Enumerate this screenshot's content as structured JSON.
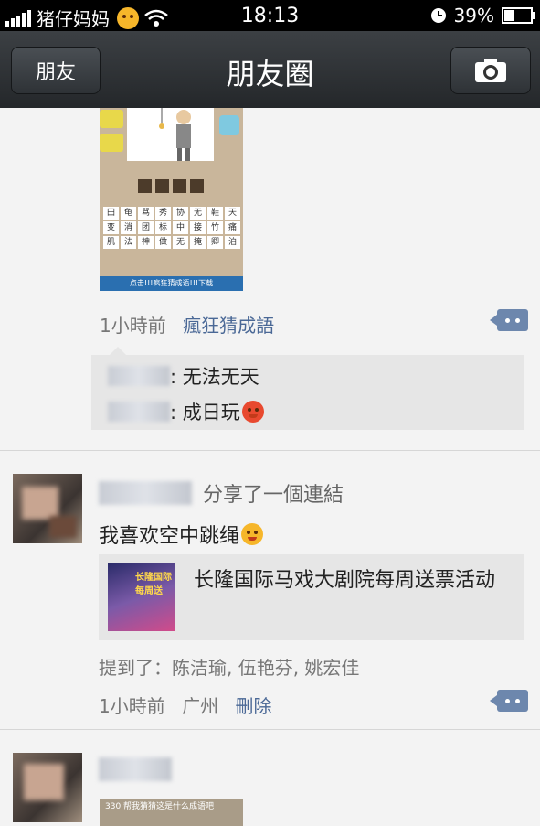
{
  "status_bar": {
    "carrier": "猪仔妈妈",
    "time": "18:13",
    "battery": "39%",
    "battery_level": 0.39
  },
  "nav": {
    "back_label": "朋友",
    "title": "朋友圈",
    "camera_icon": "camera-icon"
  },
  "post1": {
    "image": {
      "chars_row1": [
        "田",
        "龟",
        "骂",
        "秀",
        "协",
        "无",
        "鞋",
        "天"
      ],
      "chars_row2": [
        "变",
        "消",
        "团",
        "标",
        "中",
        "接",
        "竹",
        "痛"
      ],
      "chars_row3": [
        "肌",
        "法",
        "神",
        "做",
        "无",
        "掩",
        "卿",
        "泊"
      ],
      "footer": "点击!!!疯狂猜成语!!!下载"
    },
    "time": "1小時前",
    "app_link": "瘋狂猜成語",
    "comments": [
      {
        "text": ": 无法无天"
      },
      {
        "text": ": 成日玩"
      }
    ]
  },
  "post2": {
    "action": "分享了一個連結",
    "text": "我喜欢空中跳绳",
    "link_title": "长隆国际马戏大剧院每周送票活动",
    "thumb_text": "长隆国际 每周送",
    "mentions": "提到了：陈洁瑜, 伍艳芬, 姚宏佳",
    "time": "1小時前",
    "location": "广州",
    "delete": "刪除"
  },
  "post3": {
    "image_text": "330 帮我猜猜这是什么成语吧"
  }
}
